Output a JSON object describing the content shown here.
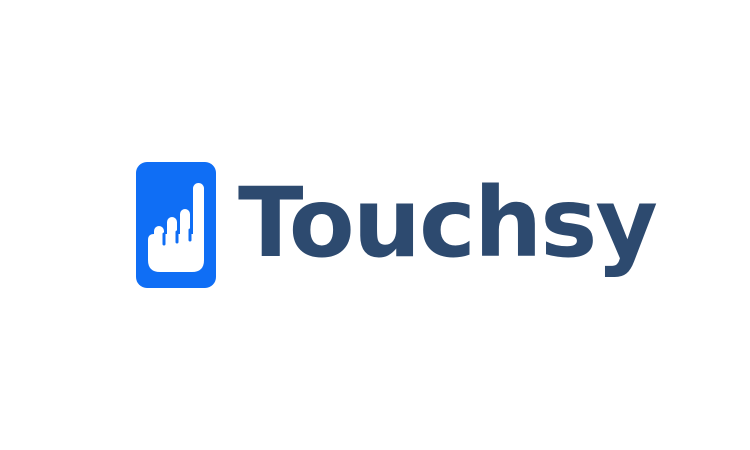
{
  "brand": {
    "name": "Touchsy",
    "icon": "pointing-hand-icon",
    "colors": {
      "icon_background": "#0f6ef5",
      "icon_glyph": "#ffffff",
      "wordmark": "#2d4a6f",
      "page_background": "#ffffff"
    }
  }
}
